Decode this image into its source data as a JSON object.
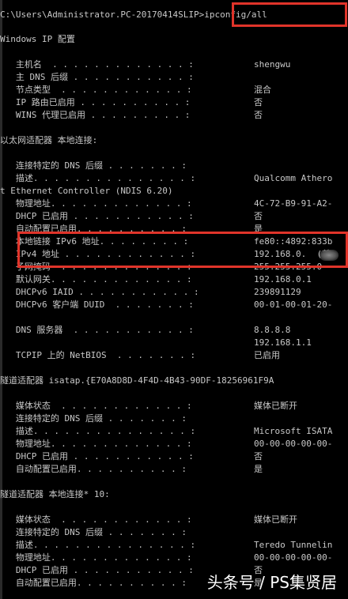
{
  "terminal": {
    "lines": [
      {
        "text": "C:\\Users\\Administrator.PC-20170414SLIP>ipconfig/all",
        "value": ""
      },
      {
        "text": "Windows IP 配置",
        "value": ""
      },
      {
        "text": "   主机名  . . . . . . . . . . . . . :",
        "value": "shengwu"
      },
      {
        "text": "   主 DNS 后缀 . . . . . . . . . . . :",
        "value": ""
      },
      {
        "text": "   节点类型  . . . . . . . . . . . . :",
        "value": "混合"
      },
      {
        "text": "   IP 路由已启用 . . . . . . . . . . :",
        "value": "否"
      },
      {
        "text": "   WINS 代理已启用 . . . . . . . . . :",
        "value": "否"
      },
      {
        "text": "以太网适配器 本地连接:",
        "value": ""
      },
      {
        "text": "   连接特定的 DNS 后缀 . . . . . . . :",
        "value": ""
      },
      {
        "text": "   描述. . . . . . . . . . . . . . . :",
        "value": "Qualcomm Athero"
      },
      {
        "text": "t Ethernet Controller (NDIS 6.20)",
        "value": ""
      },
      {
        "text": "   物理地址. . . . . . . . . . . . . :",
        "value": "4C-72-B9-91-A2-"
      },
      {
        "text": "   DHCP 已启用 . . . . . . . . . . . :",
        "value": "否"
      },
      {
        "text": "   自动配置已启用. . . . . . . . . . :",
        "value": "是"
      },
      {
        "text": "   本地链接 IPv6 地址. . . . . . . . :",
        "value": "fe80::4892:833b"
      },
      {
        "text": "   IPv4 地址 . . . . . . . . . . . . :",
        "value": "192.168.0.  (首"
      },
      {
        "text": "   子网掩码  . . . . . . . . . . . . :",
        "value": "255.255.255.0"
      },
      {
        "text": "   默认网关. . . . . . . . . . . . . :",
        "value": "192.168.0.1"
      },
      {
        "text": "   DHCPv6 IAID . . . . . . . . . . . :",
        "value": "239891129"
      },
      {
        "text": "   DHCPv6 客户端 DUID  . . . . . . . :",
        "value": "00-01-00-01-20-"
      },
      {
        "text": "   DNS 服务器  . . . . . . . . . . . :",
        "value": "8.8.8.8"
      },
      {
        "text": "",
        "value": "192.168.1.1"
      },
      {
        "text": "   TCPIP 上的 NetBIOS  . . . . . . . :",
        "value": "已启用"
      },
      {
        "text": "隧道适配器 isatap.{E70A8D8D-4F4D-4B43-90DF-18256961F9A",
        "value": ""
      },
      {
        "text": "   媒体状态  . . . . . . . . . . . . :",
        "value": "媒体已断开"
      },
      {
        "text": "   连接特定的 DNS 后缀 . . . . . . . :",
        "value": ""
      },
      {
        "text": "   描述. . . . . . . . . . . . . . . :",
        "value": "Microsoft ISATA"
      },
      {
        "text": "   物理地址. . . . . . . . . . . . . :",
        "value": "00-00-00-00-00-"
      },
      {
        "text": "   DHCP 已启用 . . . . . . . . . . . :",
        "value": "否"
      },
      {
        "text": "   自动配置已启用. . . . . . . . . . :",
        "value": "是"
      },
      {
        "text": "隧道适配器 本地连接* 10:",
        "value": ""
      },
      {
        "text": "   媒体状态  . . . . . . . . . . . . :",
        "value": "媒体已断开"
      },
      {
        "text": "   连接特定的 DNS 后缀 . . . . . . . :",
        "value": ""
      },
      {
        "text": "   描述. . . . . . . . . . . . . . . :",
        "value": "Teredo Tunnelin"
      },
      {
        "text": "   物理地址. . . . . . . . . . . . . :",
        "value": "00-00-00-00-00-"
      },
      {
        "text": "   DHCP 已启用 . . . . . . . . . . . :",
        "value": "否"
      },
      {
        "text": "   自动配置已启用. . . . . . . . . . :",
        "value": "是"
      }
    ]
  },
  "watermark": "头条号 / PS集贤居",
  "colors": {
    "background": "#000000",
    "text": "#c8c8c8",
    "highlight_box": "#e0342a"
  }
}
